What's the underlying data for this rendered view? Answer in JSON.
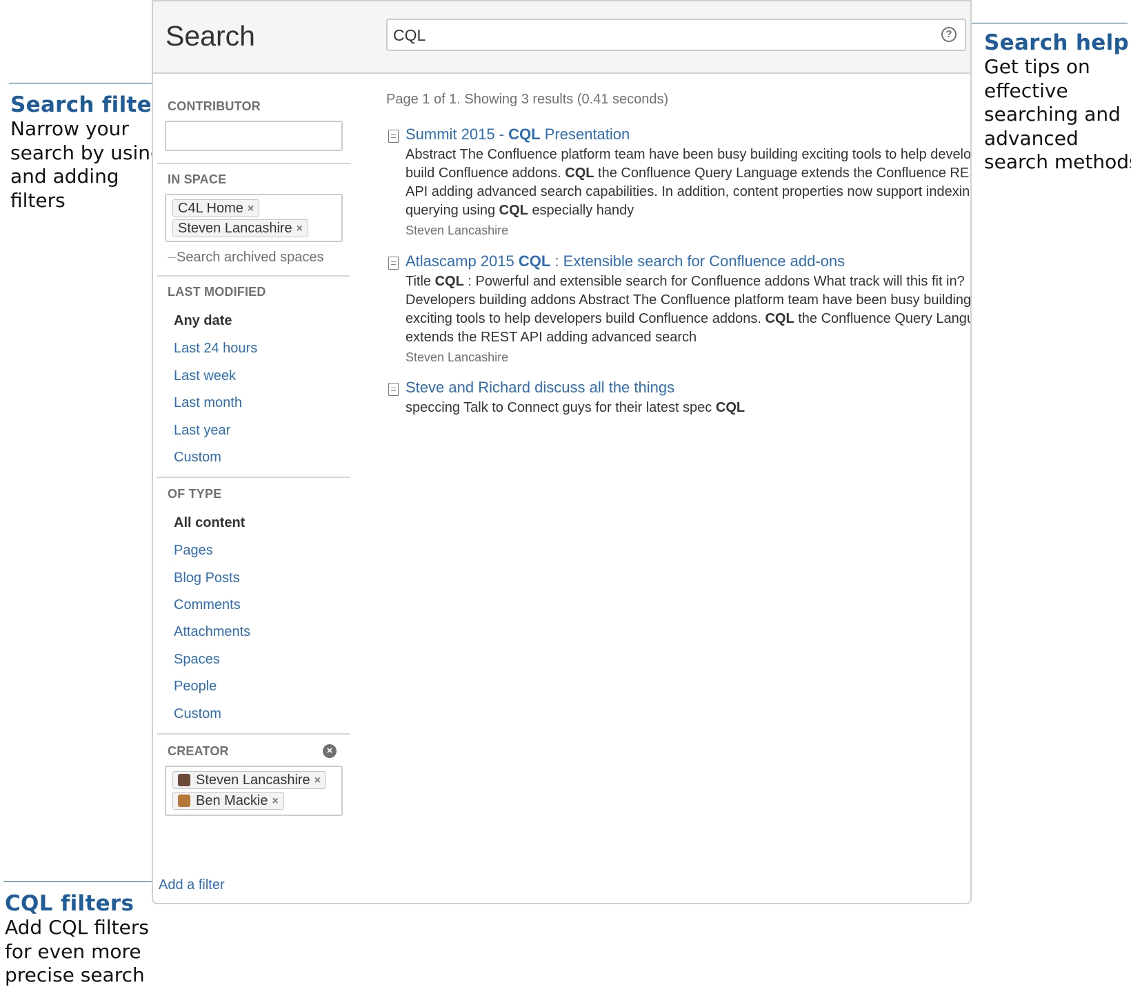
{
  "annotations": {
    "search_filters": {
      "title": "Search filters",
      "lines": [
        "Narrow your",
        "search by using",
        "and adding",
        "filters"
      ]
    },
    "search_help": {
      "title": "Search help",
      "lines": [
        "Get tips on",
        "effective",
        "searching and",
        "advanced",
        "search methods"
      ]
    },
    "cql_filters": {
      "title": "CQL filters",
      "lines": [
        "Add CQL filters",
        "for even more",
        "precise search"
      ]
    }
  },
  "header": {
    "title": "Search",
    "search_value": "CQL",
    "help_icon": "question-circle-icon",
    "help_glyph": "?"
  },
  "sidebar": {
    "contributor": {
      "title": "CONTRIBUTOR",
      "value": ""
    },
    "in_space": {
      "title": "IN SPACE",
      "tags": [
        {
          "label": "C4L Home",
          "remove": "×"
        },
        {
          "label": "Steven Lancashire",
          "remove": "×"
        }
      ],
      "archived_label": "Search archived spaces"
    },
    "last_modified": {
      "title": "LAST MODIFIED",
      "options": [
        "Any date",
        "Last 24 hours",
        "Last week",
        "Last month",
        "Last year",
        "Custom"
      ],
      "selected": "Any date"
    },
    "of_type": {
      "title": "OF TYPE",
      "options": [
        "All content",
        "Pages",
        "Blog Posts",
        "Comments",
        "Attachments",
        "Spaces",
        "People",
        "Custom"
      ],
      "selected": "All content"
    },
    "creator": {
      "title": "CREATOR",
      "clear_glyph": "×",
      "tags": [
        {
          "label": "Steven Lancashire",
          "remove": "×",
          "avatar_color": "#6b4a3a"
        },
        {
          "label": "Ben Mackie",
          "remove": "×",
          "avatar_color": "#b5763a"
        }
      ]
    },
    "add_filter": "Add a filter"
  },
  "results": {
    "summary": "Page 1 of 1. Showing 3 results (0.41 seconds)",
    "items": [
      {
        "title_pre": "Summit 2015 - ",
        "title_bold": "CQL",
        "title_post": " Presentation",
        "excerpt": [
          [
            {
              "t": "Abstract The Confluence platform team have been busy building exciting tools to help developers"
            }
          ],
          [
            {
              "t": "build Confluence addons. "
            },
            {
              "b": "CQL"
            },
            {
              "t": " the Confluence Query Language extends the Confluence REST"
            }
          ],
          [
            {
              "t": "API adding advanced search capabilities. In addition, content properties now support indexing and"
            }
          ],
          [
            {
              "t": "querying using "
            },
            {
              "b": "CQL"
            },
            {
              "t": " especially handy"
            }
          ]
        ],
        "author": "Steven Lancashire"
      },
      {
        "title_pre": "Atlascamp 2015 ",
        "title_bold": "CQL",
        "title_post": " : Extensible search for Confluence add-ons",
        "excerpt": [
          [
            {
              "t": "Title "
            },
            {
              "b": "CQL"
            },
            {
              "t": " : Powerful and extensible search for Confluence addons What track will this fit in?"
            }
          ],
          [
            {
              "t": "Developers building addons Abstract The Confluence platform team have been busy building"
            }
          ],
          [
            {
              "t": "exciting tools to help developers build Confluence addons. "
            },
            {
              "b": "CQL"
            },
            {
              "t": " the Confluence Query Language"
            }
          ],
          [
            {
              "t": "extends the REST API adding advanced search"
            }
          ]
        ],
        "author": "Steven Lancashire"
      },
      {
        "title_pre": "Steve and Richard discuss all the things",
        "title_bold": "",
        "title_post": "",
        "excerpt": [
          [
            {
              "t": "speccing Talk to Connect guys for their latest spec "
            },
            {
              "b": "CQL"
            }
          ]
        ],
        "author": ""
      }
    ]
  },
  "colors": {
    "annotation": "#1f5c9a",
    "link": "#2d6db5",
    "muted": "#707070",
    "header_bg": "#f5f5f5"
  }
}
